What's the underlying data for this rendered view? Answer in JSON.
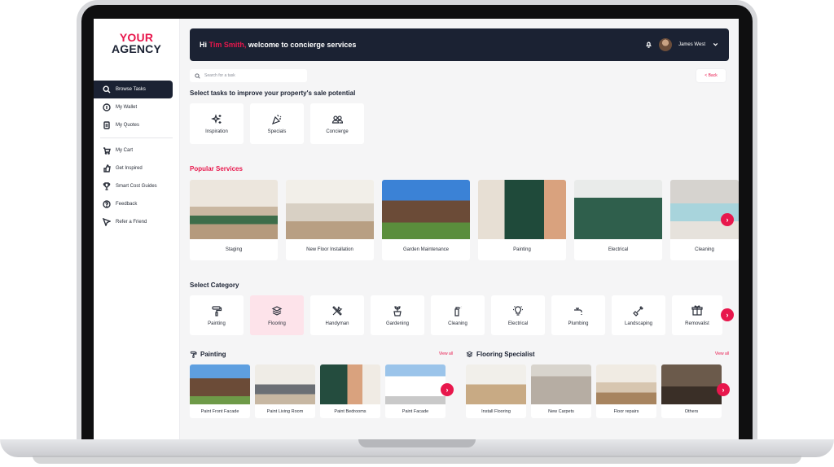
{
  "brand": {
    "line1": "YOUR",
    "line2": "AGENCY"
  },
  "sidebar": {
    "items": [
      {
        "label": "Browse Tasks",
        "icon": "search-icon",
        "active": true
      },
      {
        "label": "My Wallet",
        "icon": "wallet-icon"
      },
      {
        "label": "My Quotes",
        "icon": "quote-icon"
      },
      {
        "label": "My Cart",
        "icon": "cart-icon"
      },
      {
        "label": "Get Inspired",
        "icon": "thumbs-up-icon"
      },
      {
        "label": "Smart Cost Guides",
        "icon": "trophy-icon"
      },
      {
        "label": "Feedback",
        "icon": "help-icon"
      },
      {
        "label": "Refer a Friend",
        "icon": "send-icon"
      }
    ]
  },
  "header": {
    "greeting_prefix": "Hi",
    "user_name": "Tim Smith,",
    "greeting_suffix": "welcome to concierge services",
    "account_name": "James West"
  },
  "search": {
    "placeholder": "Search for a task"
  },
  "back_label": "< Back",
  "tasks_title": "Select tasks to improve your property's sale potential",
  "tasks": [
    {
      "label": "Inspiration",
      "icon": "sparkle-icon"
    },
    {
      "label": "Specials",
      "icon": "party-icon"
    },
    {
      "label": "Concierge",
      "icon": "people-icon"
    }
  ],
  "popular_title": "Popular Services",
  "popular": [
    {
      "label": "Staging"
    },
    {
      "label": "New Floor Installation"
    },
    {
      "label": "Garden Maintenance"
    },
    {
      "label": "Painting"
    },
    {
      "label": "Electrical"
    },
    {
      "label": "Cleaning"
    }
  ],
  "category_title": "Select Category",
  "categories": [
    {
      "label": "Painting",
      "icon": "paint-roller-icon"
    },
    {
      "label": "Flooring",
      "icon": "layers-icon",
      "selected": true
    },
    {
      "label": "Handyman",
      "icon": "tools-icon"
    },
    {
      "label": "Gardening",
      "icon": "plant-icon"
    },
    {
      "label": "Cleaning",
      "icon": "spray-icon"
    },
    {
      "label": "Electrical",
      "icon": "bulb-icon"
    },
    {
      "label": "Plumbing",
      "icon": "tap-icon"
    },
    {
      "label": "Landscaping",
      "icon": "shovel-icon"
    },
    {
      "label": "Removalist",
      "icon": "box-icon"
    }
  ],
  "painting_section": {
    "title": "Painting",
    "view_all": "View all",
    "items": [
      "Paint Front Facade",
      "Paint Living Room",
      "Paint Bedrooms",
      "Paint Facade"
    ]
  },
  "flooring_section": {
    "title": "Flooring Specialist",
    "view_all": "View all",
    "items": [
      "Install Flooring",
      "New Carpets",
      "Floor repairs",
      "Others"
    ]
  },
  "colors": {
    "accent": "#e8174c",
    "navy": "#1b2233"
  }
}
